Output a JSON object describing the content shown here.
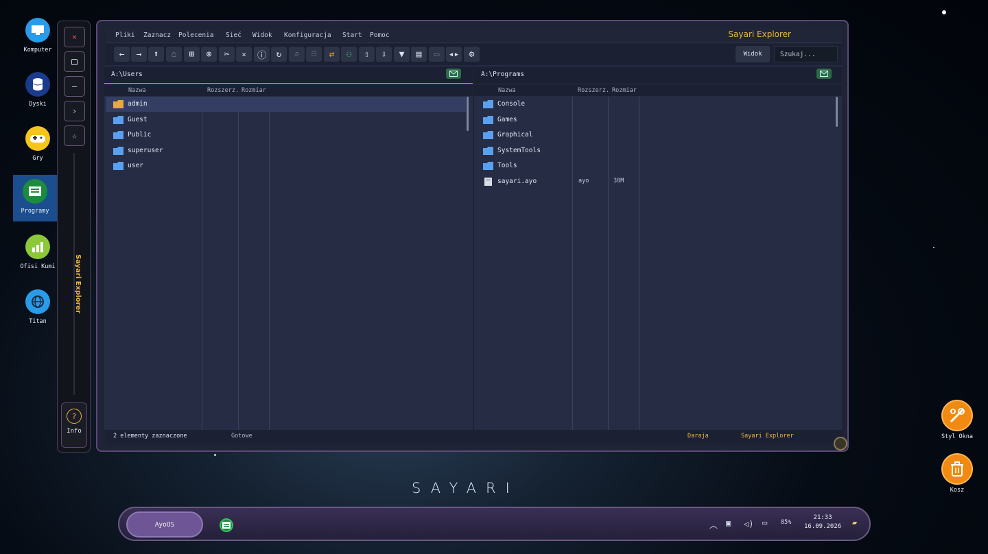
{
  "desktop": {
    "icons": [
      {
        "label": "Komputer"
      },
      {
        "label": "Dyski"
      },
      {
        "label": "Gry"
      },
      {
        "label": "Programy"
      },
      {
        "label": "Ofisi Kumi"
      },
      {
        "label": "Titan"
      }
    ],
    "right_icons": [
      {
        "label": "Styl Okna"
      },
      {
        "label": "Kosz"
      }
    ],
    "brand": "SAYARI"
  },
  "side_panel": {
    "vertical_title": "Sayari Explorer",
    "info_label": "Info",
    "buttons": [
      "close-icon",
      "maximize-icon",
      "minimize-icon",
      "chevron-right-icon",
      "star-icon"
    ]
  },
  "window": {
    "title": "Sayari Explorer",
    "menu": [
      "Pliki",
      "Zaznacz",
      "Polecenia",
      "Sieć",
      "Widok",
      "Konfiguracja",
      "Start",
      "Pomoc"
    ],
    "view_button": "Widok",
    "search_placeholder": "Szukaj..."
  },
  "left_pane": {
    "path": "A:\\Users",
    "columns": {
      "name": "Nazwa",
      "ext": "Rozszerz.",
      "size": "Rozmiar"
    },
    "rows": [
      {
        "name": "admin",
        "ext": "",
        "size": "",
        "selected": true
      },
      {
        "name": "Guest",
        "ext": "",
        "size": ""
      },
      {
        "name": "Public",
        "ext": "",
        "size": ""
      },
      {
        "name": "superuser",
        "ext": "",
        "size": ""
      },
      {
        "name": "user",
        "ext": "",
        "size": ""
      }
    ]
  },
  "right_pane": {
    "path": "A:\\Programs",
    "columns": {
      "name": "Nazwa",
      "ext": "Rozszerz.",
      "size": "Rozmiar"
    },
    "rows": [
      {
        "name": "Console",
        "ext": "",
        "size": ""
      },
      {
        "name": "Games",
        "ext": "",
        "size": ""
      },
      {
        "name": "Graphical",
        "ext": "",
        "size": ""
      },
      {
        "name": "SystemTools",
        "ext": "",
        "size": ""
      },
      {
        "name": "Tools",
        "ext": "",
        "size": ""
      },
      {
        "name": "sayari.ayo",
        "ext": "ayo",
        "size": "38M",
        "type": "file"
      }
    ]
  },
  "status": {
    "selected": "2 elementy zaznaczone",
    "state": "Gotowe",
    "user": "Daraja",
    "app": "Sayari Explorer"
  },
  "taskbar": {
    "start_label": "AyoOS",
    "battery": "85%",
    "time": "21:33",
    "date": "16.09.2026"
  },
  "colors": {
    "accent": "#f0b840",
    "selection": "#333e62",
    "folder": "#5aa0f0",
    "folder_selected": "#e8a840"
  }
}
